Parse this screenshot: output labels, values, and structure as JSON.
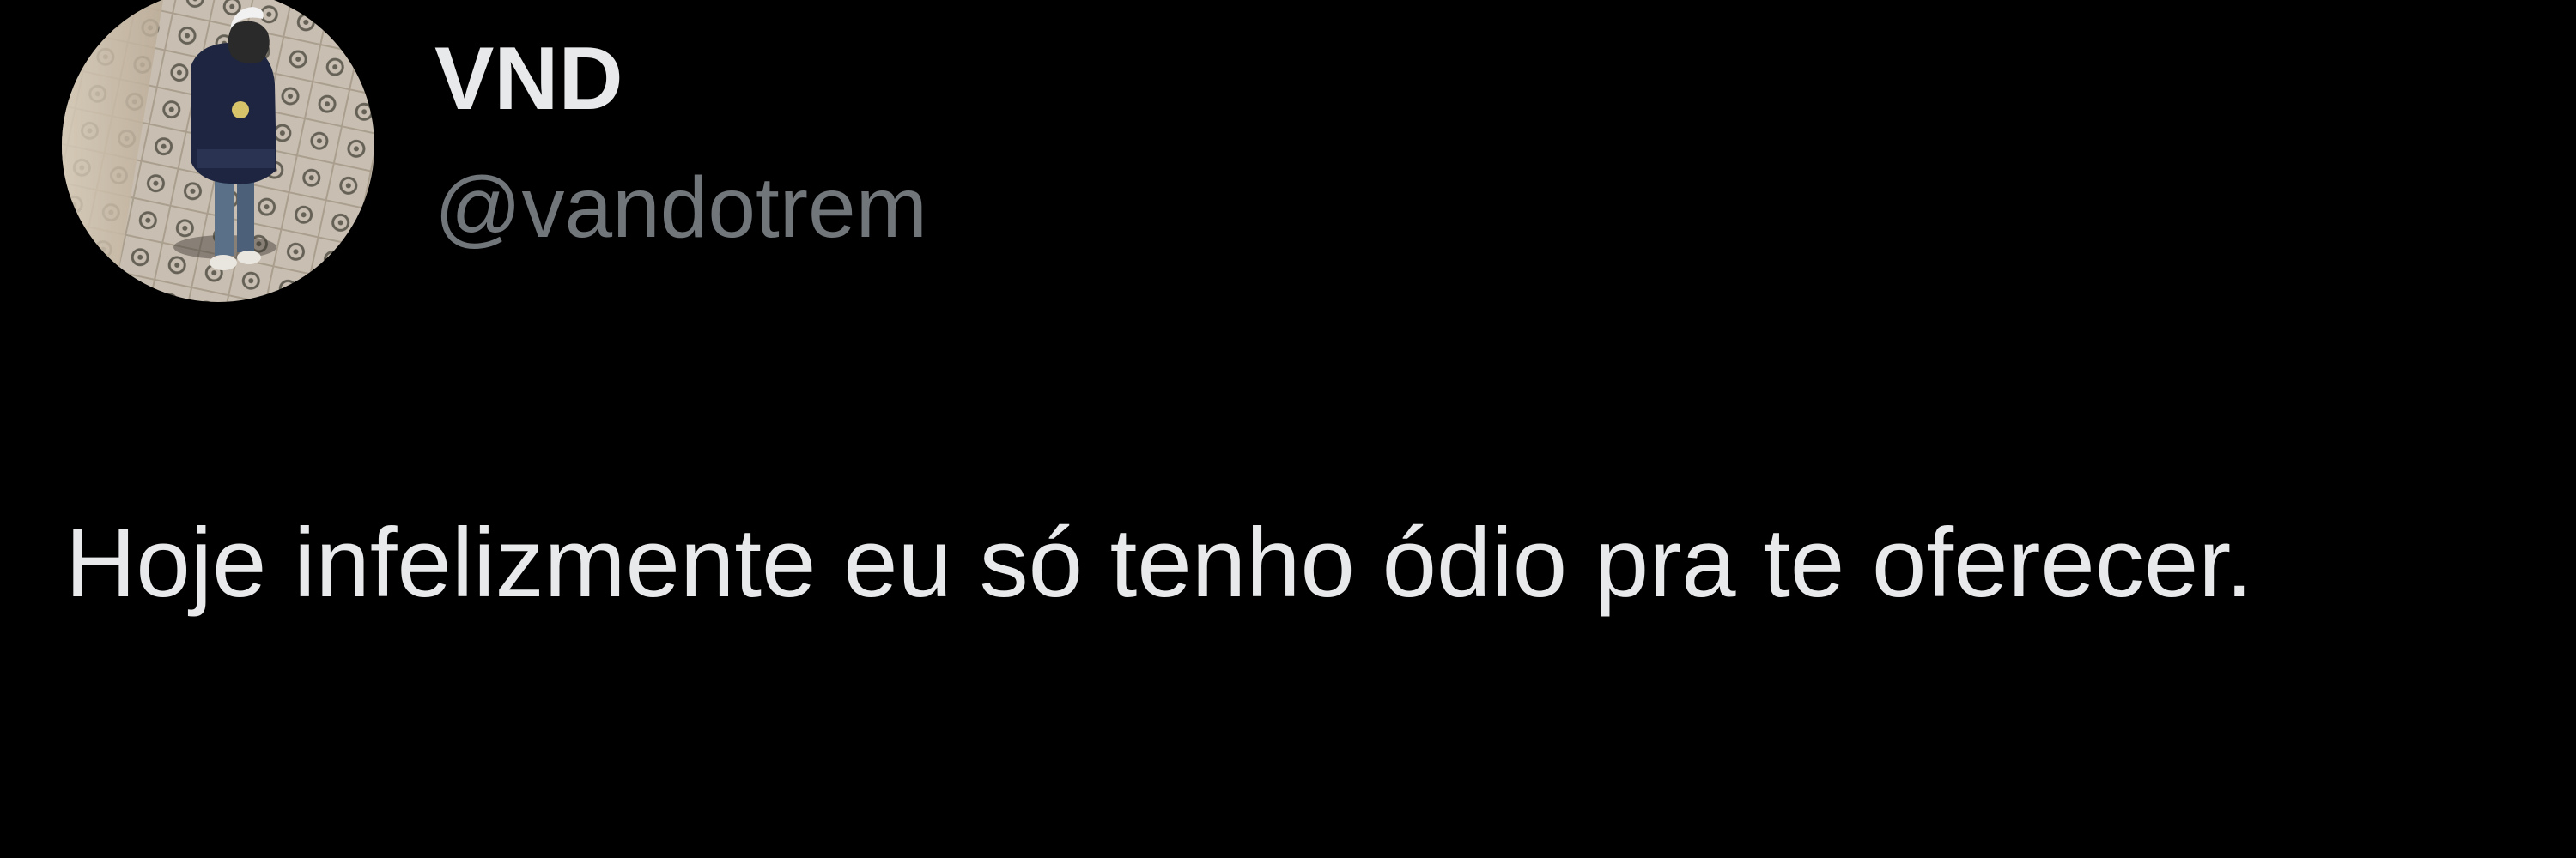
{
  "tweet": {
    "author": {
      "display_name": "VND",
      "handle": "@vandotrem",
      "avatar": "user-avatar-photo"
    },
    "text": "Hoje infelizmente eu só tenho ódio pra te oferecer."
  },
  "colors": {
    "background": "#000000",
    "primary_text": "#e7e9ea",
    "secondary_text": "#71767b"
  }
}
